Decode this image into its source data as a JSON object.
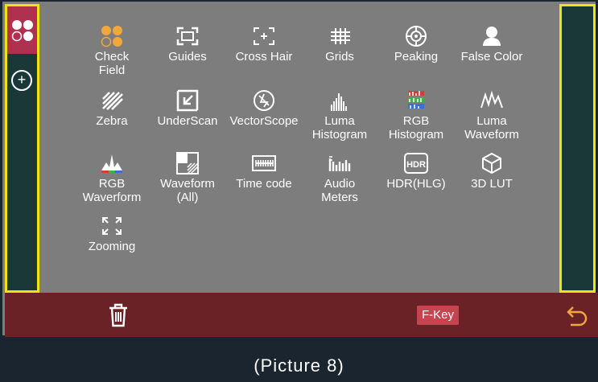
{
  "features": [
    {
      "label": "Check\nField",
      "icon": "check-field-icon"
    },
    {
      "label": "Guides",
      "icon": "guides-icon"
    },
    {
      "label": "Cross Hair",
      "icon": "cross-hair-icon"
    },
    {
      "label": "Grids",
      "icon": "grids-icon"
    },
    {
      "label": "Peaking",
      "icon": "peaking-icon"
    },
    {
      "label": "False Color",
      "icon": "false-color-icon"
    },
    {
      "label": "Zebra",
      "icon": "zebra-icon"
    },
    {
      "label": "UnderScan",
      "icon": "underscan-icon"
    },
    {
      "label": "VectorScope",
      "icon": "vectorscope-icon"
    },
    {
      "label": "Luma\nHistogram",
      "icon": "luma-histogram-icon"
    },
    {
      "label": "RGB\nHistogram",
      "icon": "rgb-histogram-icon"
    },
    {
      "label": "Luma\nWaveform",
      "icon": "luma-waveform-icon"
    },
    {
      "label": "RGB\nWaverform",
      "icon": "rgb-waveform-icon"
    },
    {
      "label": "Waveform\n(All)",
      "icon": "waveform-all-icon"
    },
    {
      "label": "Time code",
      "icon": "time-code-icon"
    },
    {
      "label": "Audio\nMeters",
      "icon": "audio-meters-icon"
    },
    {
      "label": "HDR(HLG)",
      "icon": "hdr-hlg-icon"
    },
    {
      "label": "3D LUT",
      "icon": "3d-lut-icon"
    },
    {
      "label": "Zooming",
      "icon": "zooming-icon"
    }
  ],
  "bottom_bar": {
    "fkey_label": "F-Key",
    "trash_icon": "trash-icon",
    "back_icon": "back-arrow-icon"
  },
  "sidebar": {
    "add_icon": "plus-circle-icon",
    "active_icon": "check-field-icon"
  },
  "caption": "(Picture 8)",
  "colors": {
    "highlight_border": "#f0e40a",
    "bottom_bar": "#6a2226",
    "fkey_button": "#c54450",
    "accent_orange": "#f2a73b"
  }
}
